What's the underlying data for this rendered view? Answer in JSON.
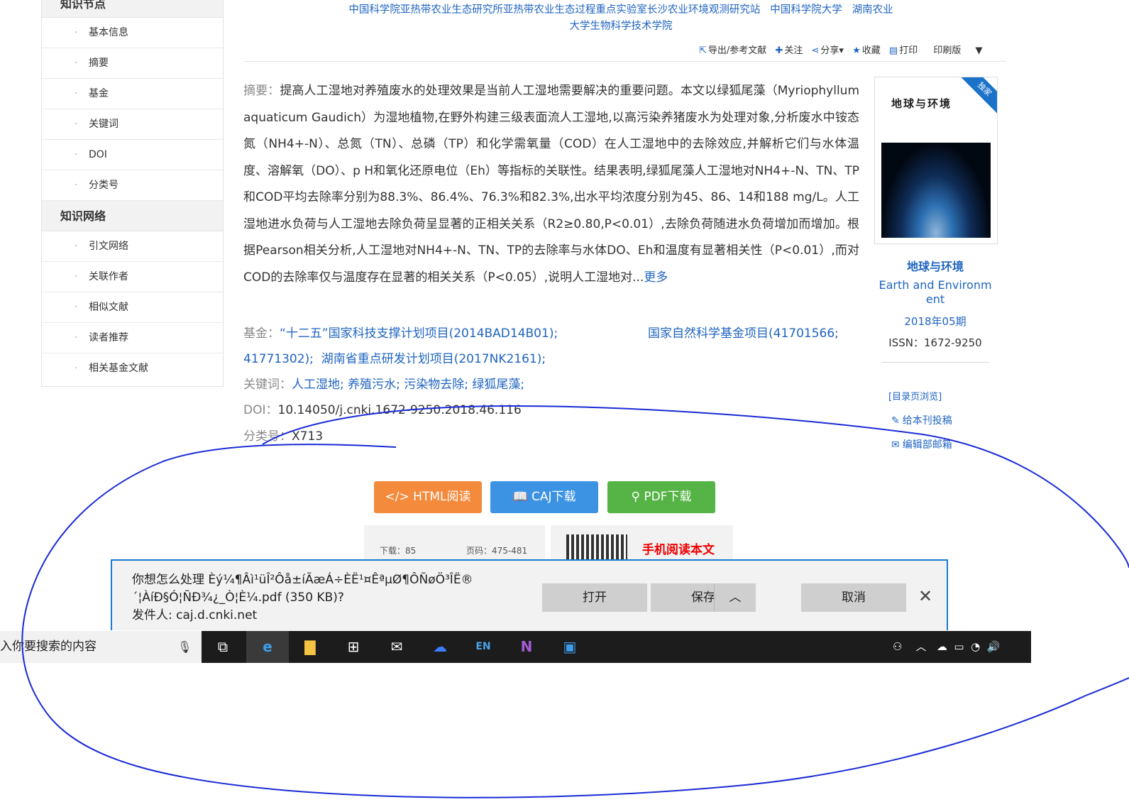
{
  "leftnav": {
    "section1_title": "知识节点",
    "section1_items": [
      "基本信息",
      "摘要",
      "基金",
      "关键词",
      "DOI",
      "分类号"
    ],
    "section2_title": "知识网络",
    "section2_items": [
      "引文网络",
      "关联作者",
      "相似文献",
      "读者推荐",
      "相关基金文献"
    ]
  },
  "affiliation": {
    "line1": "中国科学院亚热带农业生态研究所亚热带农业生态过程重点实验室长沙农业环境观测研究站   中国科学院大学   湖南农业",
    "line2": "大学生物科学技术学院"
  },
  "toolbar": {
    "export": "导出/参考文献",
    "follow": "关注",
    "share": "分享",
    "favorite": "收藏",
    "print": "打印",
    "print_version": "印刷版"
  },
  "abstract": {
    "label": "摘要：",
    "text": "提高人工湿地对养殖废水的处理效果是当前人工湿地需要解决的重要问题。本文以绿狐尾藻（Myriophyllum aquaticum Gaudich）为湿地植物,在野外构建三级表面流人工湿地,以高污染养猪废水为处理对象,分析废水中铵态氮（NH4+-N）、总氮（TN）、总磷（TP）和化学需氧量（COD）在人工湿地中的去除效应,并解析它们与水体温度、溶解氧（DO）、p H和氧化还原电位（Eh）等指标的关联性。结果表明,绿狐尾藻人工湿地对NH4+-N、TN、TP和COD平均去除率分别为88.3%、86.4%、76.3%和82.3%,出水平均浓度分别为45、86、14和188 mg/L。人工湿地进水负荷与人工湿地去除负荷呈显著的正相关关系（R2≥0.80,P<0.01）,去除负荷随进水负荷增加而增加。根据Pearson相关分析,人工湿地对NH4+-N、TN、TP的去除率与水体DO、Eh和温度有显著相关性（P<0.01）,而对COD的去除率仅与温度存在显著的相关关系（P<0.05）,说明人工湿地对...",
    "more": "更多"
  },
  "fund": {
    "label": "基金：",
    "item1": "“十二五”国家科技支撑计划项目(2014BAD14B01);",
    "item2": "国家自然科学基金项目(41701566;",
    "item3": "41771302);",
    "item4": "湖南省重点研发计划项目(2017NK2161);"
  },
  "keywords": {
    "label": "关键词：",
    "items": [
      "人工湿地;",
      "养殖污水;",
      "污染物去除;",
      "绿狐尾藻;"
    ]
  },
  "doi": {
    "label": "DOI：",
    "value": "10.14050/j.cnki.1672-9250.2018.46.116"
  },
  "classno": {
    "label": "分类号：",
    "value": "X713"
  },
  "journal": {
    "cover_title": "地球与环境",
    "cover_badge": "独家",
    "name_cn": "地球与环境",
    "name_en_1": "Earth and Environm",
    "name_en_2": "ent",
    "issue": "2018年05期",
    "issn": "ISSN：1672-9250",
    "toc": "[目录页浏览]",
    "submit": "给本刊投稿",
    "editor": "编辑部邮箱"
  },
  "buttons": {
    "html": "HTML阅读",
    "caj": "CAJ下载",
    "pdf": "PDF下载"
  },
  "info": {
    "downloads": "下载：85",
    "pages": "页码：475-481"
  },
  "mobile": {
    "label": "手机阅读本文"
  },
  "download_bar": {
    "line1": "你想怎么处理 Èý¼¶Âì¹üÎ²Ôå±íÃæÁ÷ÈË¹¤ÊªµØ¶ÔÑøÖ³ÎË®",
    "line2": "´¦ÀíÐ§Ó¦ÑÐ¾¿_Ò¦È¼.pdf (350 KB)?",
    "line3": "发件人: caj.d.cnki.net",
    "open": "打开",
    "save": "保存",
    "cancel": "取消"
  },
  "taskbar": {
    "search_placeholder": "入你要搜索的内容"
  },
  "colors": {
    "link": "#1f64c1",
    "html_btn": "#f48a3c",
    "caj_btn": "#3c93e4",
    "pdf_btn": "#56b446",
    "scribble": "#1a2bd6"
  }
}
